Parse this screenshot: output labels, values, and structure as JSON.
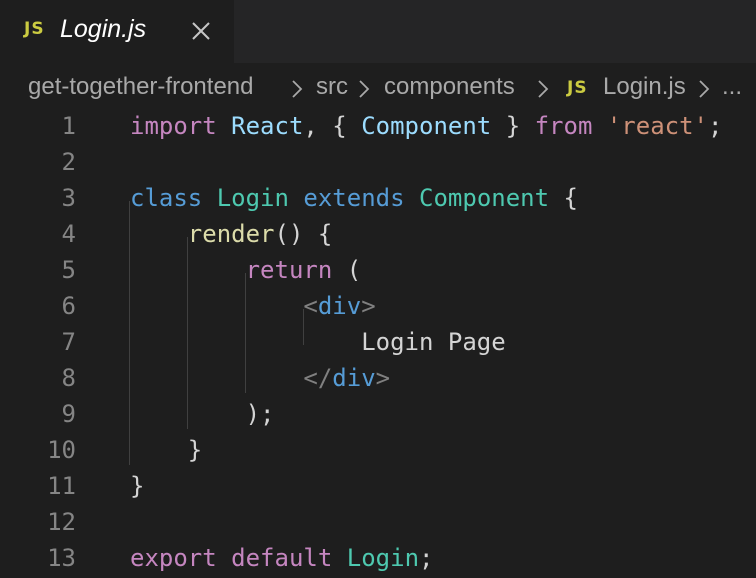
{
  "tab": {
    "badge": "JS",
    "title": "Login.js"
  },
  "breadcrumb": {
    "items": [
      "get-together-frontend",
      "src",
      "components"
    ],
    "file_badge": "JS",
    "file": "Login.js",
    "separator": ">",
    "more": "..."
  },
  "editor": {
    "line_numbers": [
      "1",
      "2",
      "3",
      "4",
      "5",
      "6",
      "7",
      "8",
      "9",
      "10",
      "11",
      "12",
      "13"
    ],
    "lines": [
      [
        [
          "kw",
          "import"
        ],
        [
          "pun",
          " "
        ],
        [
          "ident",
          "React"
        ],
        [
          "pun",
          ", { "
        ],
        [
          "ident",
          "Component"
        ],
        [
          "pun",
          " } "
        ],
        [
          "kw",
          "from"
        ],
        [
          "pun",
          " "
        ],
        [
          "str",
          "'react'"
        ],
        [
          "pun",
          ";"
        ]
      ],
      [],
      [
        [
          "kw-blue",
          "class"
        ],
        [
          "pun",
          " "
        ],
        [
          "cls",
          "Login"
        ],
        [
          "pun",
          " "
        ],
        [
          "kw-blue",
          "extends"
        ],
        [
          "pun",
          " "
        ],
        [
          "cls",
          "Component"
        ],
        [
          "pun",
          " {"
        ]
      ],
      [
        [
          "pun",
          "    "
        ],
        [
          "fn",
          "render"
        ],
        [
          "pun",
          "() {"
        ]
      ],
      [
        [
          "pun",
          "        "
        ],
        [
          "kw",
          "return"
        ],
        [
          "pun",
          " ("
        ]
      ],
      [
        [
          "pun",
          "            "
        ],
        [
          "tag-br",
          "<"
        ],
        [
          "tag",
          "div"
        ],
        [
          "tag-br",
          ">"
        ]
      ],
      [
        [
          "pun",
          "                "
        ],
        [
          "txt",
          "Login Page"
        ]
      ],
      [
        [
          "pun",
          "            "
        ],
        [
          "tag-br",
          "</"
        ],
        [
          "tag",
          "div"
        ],
        [
          "tag-br",
          ">"
        ]
      ],
      [
        [
          "pun",
          "        );"
        ]
      ],
      [
        [
          "pun",
          "    }"
        ]
      ],
      [
        [
          "pun",
          "}"
        ]
      ],
      [],
      [
        [
          "kw",
          "export"
        ],
        [
          "pun",
          " "
        ],
        [
          "kw",
          "default"
        ],
        [
          "pun",
          " "
        ],
        [
          "cls",
          "Login"
        ],
        [
          "pun",
          ";"
        ]
      ]
    ]
  },
  "colors": {
    "editor_bg": "#1e1e1e",
    "tabbar_bg": "#252526",
    "js_badge": "#cbcb41",
    "keyword_purple": "#c586c0",
    "keyword_blue": "#569cd6",
    "identifier": "#9cdcfe",
    "class_name": "#4ec9b0",
    "string": "#ce9178",
    "function": "#dcdcaa",
    "line_number": "#858585"
  },
  "icons": {
    "close": "close-icon",
    "chevron": "chevron-right-icon"
  }
}
